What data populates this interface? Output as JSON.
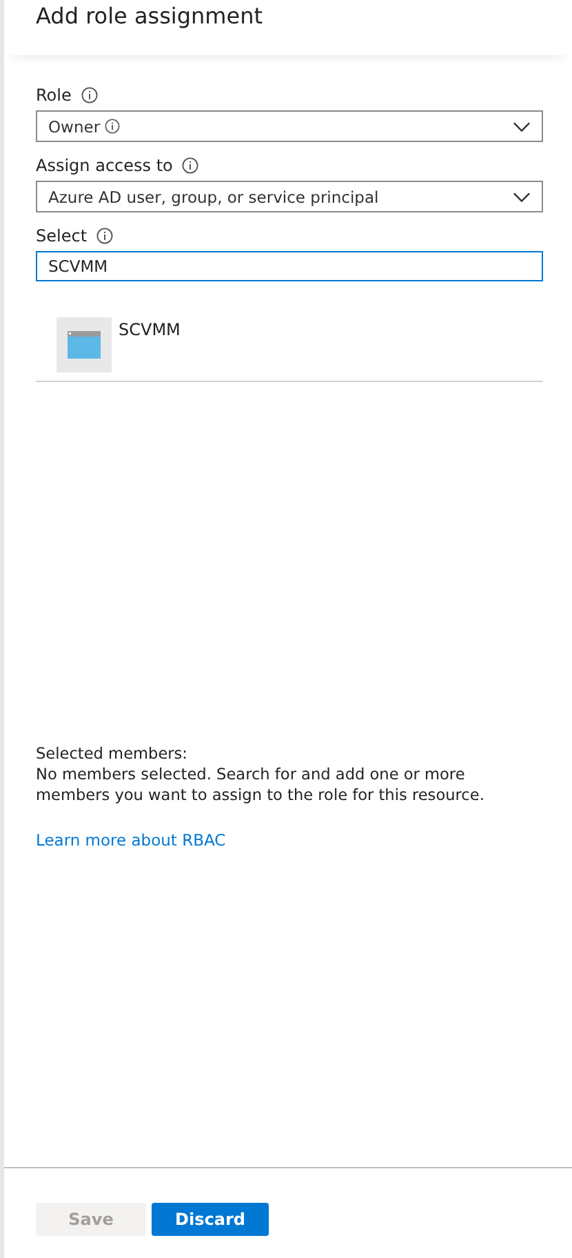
{
  "title": "Add role assignment",
  "fields": [
    {
      "kind": "dropdown",
      "label": "Role",
      "info": true,
      "value": "Owner",
      "value_info": true
    },
    {
      "kind": "dropdown",
      "label": "Assign access to",
      "info": true,
      "value": "Azure AD user, group, or service principal",
      "value_info": false
    },
    {
      "kind": "search",
      "label": "Select",
      "info": true,
      "value": "SCVMM",
      "focused": true
    }
  ],
  "results": [
    {
      "name": "SCVMM"
    }
  ],
  "selected_members": {
    "heading": "Selected members:",
    "message": "No members selected. Search for and add one or more members you want to assign to the role for this resource."
  },
  "link": "Learn more about RBAC",
  "buttons": [
    {
      "label": "Save",
      "kind": "secondary",
      "disabled": true
    },
    {
      "label": "Discard",
      "kind": "primary",
      "disabled": false
    }
  ]
}
